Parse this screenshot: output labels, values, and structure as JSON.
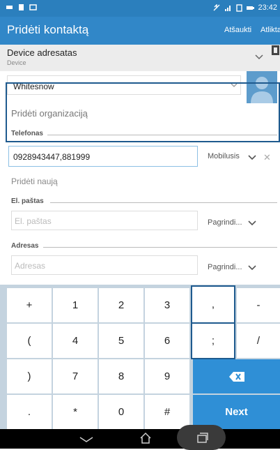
{
  "status_bar": {
    "time": "23:42"
  },
  "app_bar": {
    "title": "Pridėti kontaktą",
    "cancel_label": "Atšaukti",
    "done_label": "Atlikta"
  },
  "account": {
    "name": "Device adresatas",
    "type": "Device"
  },
  "name_field": {
    "value": "Whitesnow"
  },
  "add_organization": "Pridėti organizaciją",
  "phone": {
    "section_label": "Telefonas",
    "value": "0928943447,881999",
    "type": "Mobilusis"
  },
  "add_new": "Pridėti naują",
  "email": {
    "section_label": "El. paštas",
    "placeholder": "El. paštas",
    "type": "Pagrindi..."
  },
  "address": {
    "section_label": "Adresas",
    "placeholder": "Adresas",
    "type": "Pagrindi..."
  },
  "keypad": {
    "keys": [
      [
        "+",
        "1",
        "2",
        "3",
        ",",
        "-"
      ],
      [
        "(",
        "4",
        "5",
        "6",
        ";",
        "/"
      ],
      [
        ")",
        "7",
        "8",
        "9"
      ],
      [
        ".",
        "*",
        "0",
        "#"
      ]
    ],
    "next_label": "Next",
    "backspace_icon": "backspace-icon"
  },
  "colors": {
    "accent": "#3187c8",
    "status_bar": "#2b7fbd",
    "key_blue": "#2f8fd6",
    "focus_border": "#1e5a8e"
  }
}
